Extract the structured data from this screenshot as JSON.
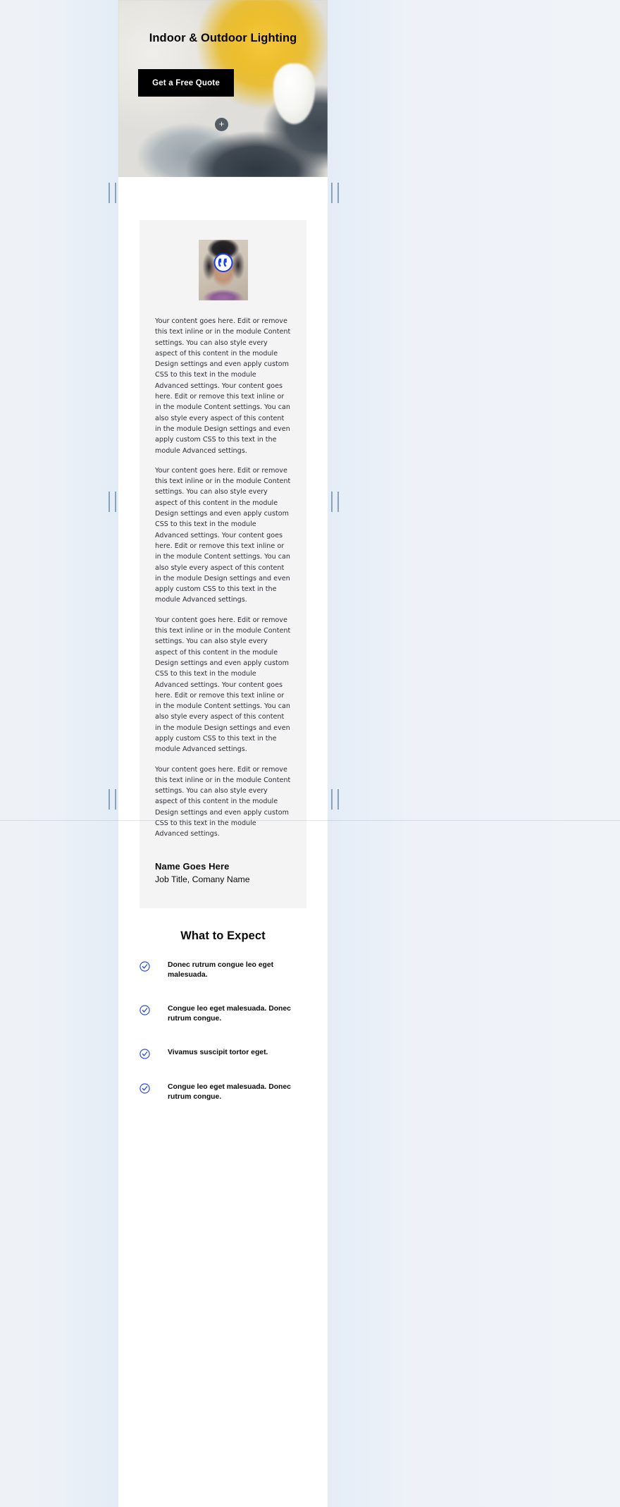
{
  "page": {
    "background_color": "#eef2f8",
    "content_background": "#ffffff",
    "accent_color": "#1b41e8",
    "card_background": "#f4f4f4"
  },
  "hero": {
    "title": "Indoor & Outdoor Lighting",
    "cta_label": "Get a Free Quote",
    "add_button_label": "+",
    "image_alt": "Electrician in yellow hard hat holding a light bulb"
  },
  "testimonial": {
    "quote_icon": "quote-mark-icon",
    "avatar_alt": "Portrait photo of smiling man",
    "paragraphs": [
      "Your content goes here. Edit or remove this text inline or in the module Content settings. You can also style every aspect of this content in the module Design settings and even apply custom CSS to this text in the module Advanced settings. Your content goes here. Edit or remove this text inline or in the module Content settings. You can also style every aspect of this content in the module Design settings and even apply custom CSS to this text in the module Advanced settings.",
      "Your content goes here. Edit or remove this text inline or in the module Content settings. You can also style every aspect of this content in the module Design settings and even apply custom CSS to this text in the module Advanced settings. Your content goes here. Edit or remove this text inline or in the module Content settings. You can also style every aspect of this content in the module Design settings and even apply custom CSS to this text in the module Advanced settings.",
      "Your content goes here. Edit or remove this text inline or in the module Content settings. You can also style every aspect of this content in the module Design settings and even apply custom CSS to this text in the module Advanced settings. Your content goes here. Edit or remove this text inline or in the module Content settings. You can also style every aspect of this content in the module Design settings and even apply custom CSS to this text in the module Advanced settings.",
      "Your content goes here. Edit or remove this text inline or in the module Content settings. You can also style every aspect of this content in the module Design settings and even apply custom CSS to this text in the module Advanced settings."
    ],
    "author_name": "Name Goes Here",
    "author_role": "Job Title, Comany Name"
  },
  "expect": {
    "title": "What to Expect",
    "items": [
      {
        "icon": "check-circle-icon",
        "text": "Donec rutrum congue leo eget malesuada."
      },
      {
        "icon": "check-circle-icon",
        "text": "Congue leo eget malesuada. Donec rutrum congue."
      },
      {
        "icon": "check-circle-icon",
        "text": "Vivamus suscipit tortor eget."
      },
      {
        "icon": "check-circle-icon",
        "text": "Congue leo eget malesuada. Donec rutrum congue."
      }
    ]
  }
}
